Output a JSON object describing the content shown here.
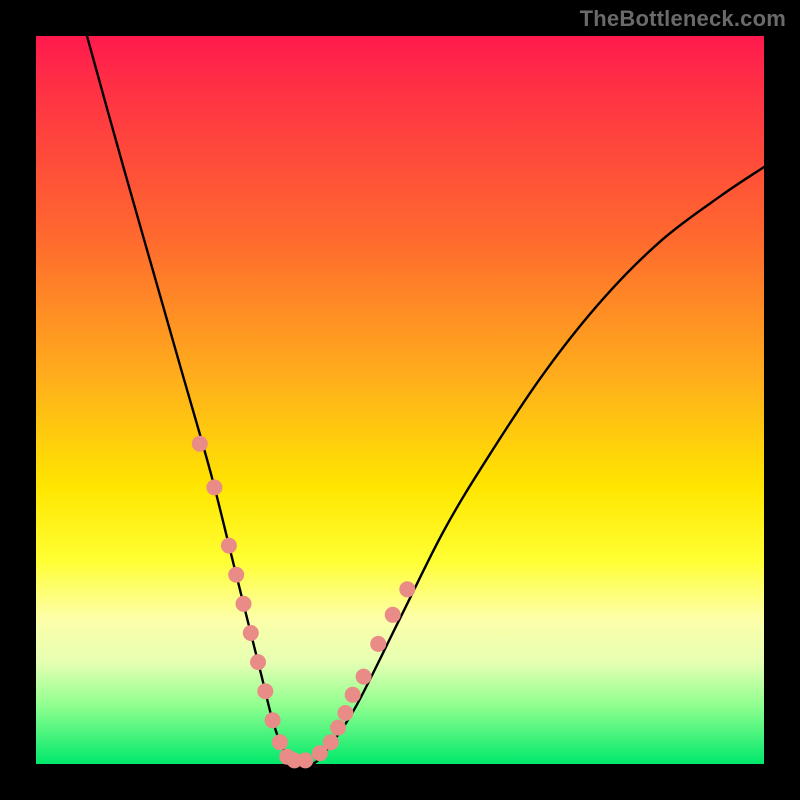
{
  "watermark": "TheBottleneck.com",
  "chart_data": {
    "type": "line",
    "title": "",
    "xlabel": "",
    "ylabel": "",
    "xlim": [
      0,
      100
    ],
    "ylim": [
      0,
      100
    ],
    "series": [
      {
        "name": "curve",
        "x": [
          7,
          12,
          16,
          20,
          24,
          27,
          29,
          31,
          32.5,
          34,
          36,
          38,
          40,
          44,
          50,
          56,
          62,
          70,
          78,
          86,
          94,
          100
        ],
        "y": [
          100,
          82,
          68,
          54,
          40,
          28,
          20,
          12,
          6,
          2,
          0,
          0,
          2,
          8,
          20,
          32,
          42,
          54,
          64,
          72,
          78,
          82
        ]
      }
    ],
    "highlights": {
      "name": "dots",
      "color": "#e98b86",
      "x": [
        22.5,
        24.5,
        26.5,
        27.5,
        28.5,
        29.5,
        30.5,
        31.5,
        32.5,
        33.5,
        34.5,
        35.5,
        37,
        39,
        40.5,
        41.5,
        42.5,
        43.5,
        45,
        47,
        49,
        51
      ],
      "y": [
        44,
        38,
        30,
        26,
        22,
        18,
        14,
        10,
        6,
        3,
        1,
        0.5,
        0.5,
        1.5,
        3,
        5,
        7,
        9.5,
        12,
        16.5,
        20.5,
        24
      ]
    },
    "gradient_stops": [
      {
        "pos": 0,
        "color": "#ff1a4d"
      },
      {
        "pos": 28,
        "color": "#ff6a2e"
      },
      {
        "pos": 62,
        "color": "#ffe600"
      },
      {
        "pos": 100,
        "color": "#00e86b"
      }
    ]
  }
}
